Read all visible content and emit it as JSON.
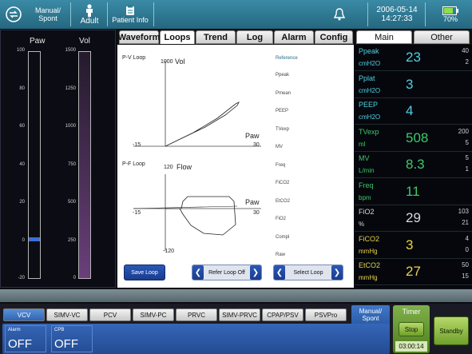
{
  "topbar": {
    "mode_label": "Manual/\nSpont",
    "patient_type": "Adult",
    "patient_info": "Patient Info",
    "date": "2006-05-14",
    "time": "14:27:33",
    "battery": "70%",
    "icons": [
      "exchange-icon",
      "person-icon",
      "clipboard-icon",
      "bell-icon",
      "battery-icon"
    ]
  },
  "left_gauges": {
    "paw": {
      "title": "Paw",
      "ticks": [
        "100",
        "80",
        "60",
        "40",
        "20",
        "0",
        "-20"
      ],
      "level_fraction": 0.17,
      "color": "#3a6fd8"
    },
    "vol": {
      "title": "Vol",
      "ticks": [
        "1500",
        "1250",
        "1000",
        "750",
        "500",
        "250",
        "0"
      ],
      "level_fraction": 0.0,
      "color": "#6a3f7a"
    }
  },
  "tabs": [
    {
      "label": "Waveform",
      "active": false
    },
    {
      "label": "Loops",
      "active": true
    },
    {
      "label": "Trend",
      "active": false
    },
    {
      "label": "Log",
      "active": false
    },
    {
      "label": "Alarm",
      "active": false
    },
    {
      "label": "Config",
      "active": false
    }
  ],
  "loops": {
    "pv": {
      "title": "P-V Loop",
      "ymax": "1000",
      "ylabel": "Vol",
      "xmin": "-15",
      "xmax": "30",
      "xlabel": "Paw"
    },
    "pf": {
      "title": "P-F Loop",
      "ymax": "120",
      "ylabel": "Flow",
      "xmin": "-15",
      "xmax": "30",
      "xlabel": "Paw",
      "ymin": "-120"
    },
    "reference_header": "Reference",
    "reference_items": [
      "Ppeak",
      "Pmean",
      "PEEP",
      "TVexp",
      "MV",
      "Freq",
      "FiCO2",
      "EtCO2",
      "FiO2",
      "Compl",
      "Raw"
    ]
  },
  "buttons": {
    "save_loop": "Save Loop",
    "refer_loop": "Refer Loop Off",
    "select_loop": "Select Loop",
    "left_arrow": "❮",
    "right_arrow": "❯"
  },
  "right_tabs": [
    {
      "label": "Main",
      "active": true
    },
    {
      "label": "Other",
      "active": false
    }
  ],
  "params": [
    {
      "name": "Ppeak",
      "unit": "cmH2O",
      "value": "23",
      "hi": "40",
      "lo": "2",
      "color": "#4fd0e0"
    },
    {
      "name": "Pplat",
      "unit": "cmH2O",
      "value": "3",
      "hi": "",
      "lo": "",
      "color": "#4fd0e0"
    },
    {
      "name": "PEEP",
      "unit": "cmH2O",
      "value": "4",
      "hi": "",
      "lo": "",
      "color": "#4fd0e0"
    },
    {
      "name": "TVexp",
      "unit": "ml",
      "value": "508",
      "hi": "200",
      "lo": "5",
      "color": "#3ec86a"
    },
    {
      "name": "MV",
      "unit": "L/min",
      "value": "8.3",
      "hi": "5",
      "lo": "1",
      "color": "#3ec86a"
    },
    {
      "name": "Freq",
      "unit": "bpm",
      "value": "11",
      "hi": "",
      "lo": "",
      "color": "#3ec86a"
    },
    {
      "name": "FiO2",
      "unit": "%",
      "value": "29",
      "hi": "103",
      "lo": "21",
      "color": "#d8d8d8"
    },
    {
      "name": "FiCO2",
      "unit": "mmHg",
      "value": "3",
      "hi": "4",
      "lo": "0",
      "color": "#e6d44a"
    },
    {
      "name": "EtCO2",
      "unit": "mmHg",
      "value": "27",
      "hi": "50",
      "lo": "15",
      "color": "#e6d44a"
    }
  ],
  "modes": [
    {
      "label": "VCV",
      "active": true
    },
    {
      "label": "SIMV-VC",
      "active": false
    },
    {
      "label": "PCV",
      "active": false
    },
    {
      "label": "SIMV-PC",
      "active": false
    },
    {
      "label": "PRVC",
      "active": false
    },
    {
      "label": "SIMV-PRVC",
      "active": false
    },
    {
      "label": "CPAP/PSV",
      "active": false
    },
    {
      "label": "PSVPro",
      "active": false
    }
  ],
  "bottom": {
    "manual_spont": "Manual/\nSpont",
    "timer_title": "Timer",
    "stop": "Stop",
    "timer_value": "03:00:14",
    "standby": "Standby",
    "alarm_label": "Alarm",
    "alarm_value": "OFF",
    "cpb_label": "CPB",
    "cpb_value": "OFF"
  }
}
